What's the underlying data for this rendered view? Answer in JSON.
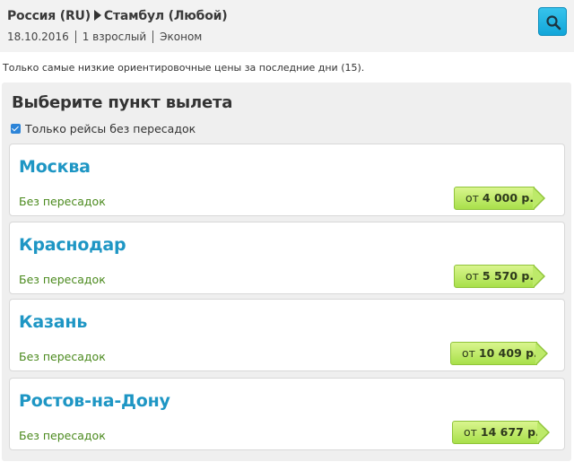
{
  "header": {
    "origin": "Россия (RU)",
    "destination": "Стамбул (Любой)",
    "date": "18.10.2016",
    "passengers": "1 взрослый",
    "cabin_class": "Эконом",
    "search_icon": "search-icon",
    "accent_color": "#1ba9dc"
  },
  "note": "Только самые низкие ориентировочные цены за последние дни (15).",
  "panel": {
    "title": "Выберите пункт вылета",
    "filter_label": "Только рейсы без пересадок",
    "filter_checked": true
  },
  "departures": [
    {
      "city": "Москва",
      "stops": "Без пересадок",
      "price_prefix": "от",
      "price": "4 000 р."
    },
    {
      "city": "Краснодар",
      "stops": "Без пересадок",
      "price_prefix": "от",
      "price": "5 570 р."
    },
    {
      "city": "Казань",
      "stops": "Без пересадок",
      "price_prefix": "от",
      "price": "10 409 р."
    },
    {
      "city": "Ростов-на-Дону",
      "stops": "Без пересадок",
      "price_prefix": "от",
      "price": "14 677 р."
    }
  ],
  "colors": {
    "city_link": "#1e96c4",
    "stops_text": "#4b8a1e",
    "price_tag": "#bdea6a"
  }
}
